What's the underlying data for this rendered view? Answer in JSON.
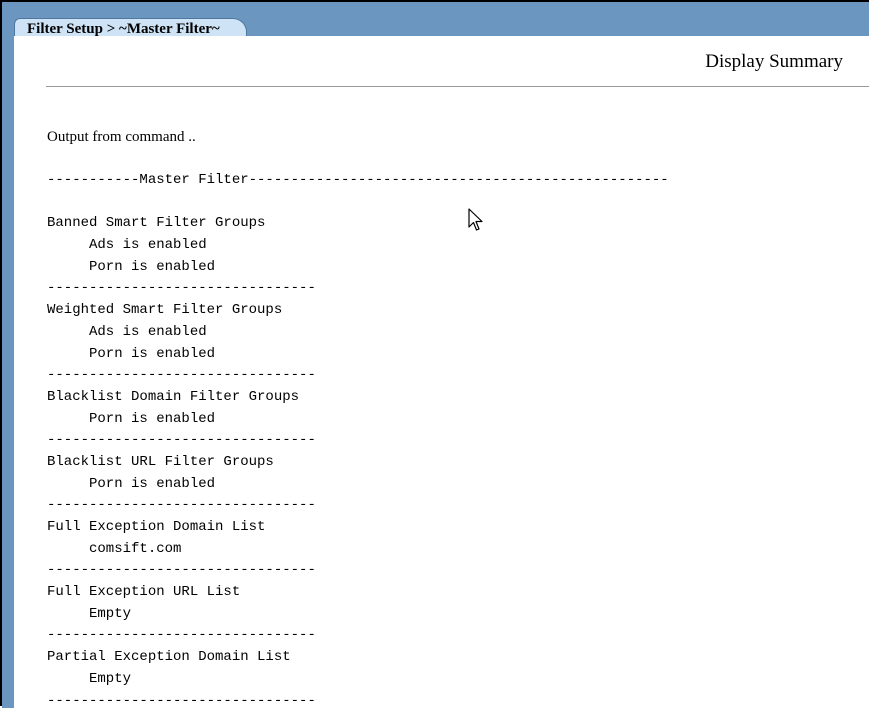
{
  "tab": {
    "label": "Filter Setup > ~Master Filter~"
  },
  "page": {
    "title": "Display Summary",
    "intro": "Output from command .."
  },
  "output_lines": [
    "-----------Master Filter--------------------------------------------------",
    "",
    "Banned Smart Filter Groups",
    "     Ads is enabled",
    "     Porn is enabled",
    "--------------------------------",
    "Weighted Smart Filter Groups",
    "     Ads is enabled",
    "     Porn is enabled",
    "--------------------------------",
    "Blacklist Domain Filter Groups",
    "     Porn is enabled",
    "--------------------------------",
    "Blacklist URL Filter Groups",
    "     Porn is enabled",
    "--------------------------------",
    "Full Exception Domain List",
    "     comsift.com",
    "--------------------------------",
    "Full Exception URL List",
    "     Empty",
    "--------------------------------",
    "Partial Exception Domain List",
    "     Empty",
    "--------------------------------"
  ],
  "icons": {
    "cursor": "mouse-pointer-icon"
  },
  "colors": {
    "header_blue": "#6b96c0",
    "tab_fill": "#cfe3f6"
  }
}
